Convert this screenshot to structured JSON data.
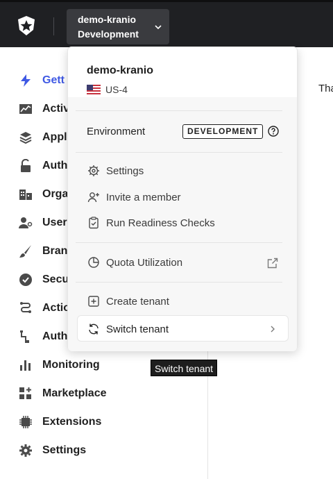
{
  "header": {
    "tenant_name": "demo-kranio",
    "tenant_environment": "Development"
  },
  "sidebar": {
    "items": [
      {
        "label": "Gett",
        "icon": "lightning-icon",
        "active": true
      },
      {
        "label": "Activ",
        "icon": "activity-chart-icon"
      },
      {
        "label": "Appl",
        "icon": "layers-icon"
      },
      {
        "label": "Auth",
        "icon": "unlock-icon"
      },
      {
        "label": "Orga",
        "icon": "buildings-icon"
      },
      {
        "label": "User",
        "icon": "users-icon"
      },
      {
        "label": "Bran",
        "icon": "brush-icon"
      },
      {
        "label": "Secu",
        "icon": "shield-icon"
      },
      {
        "label": "Actio",
        "icon": "actions-flow-icon"
      },
      {
        "label": "Auth",
        "icon": "auth-pipeline-icon"
      },
      {
        "label": "Monitoring",
        "icon": "bar-chart-icon"
      },
      {
        "label": "Marketplace",
        "icon": "grid-plus-icon"
      },
      {
        "label": "Extensions",
        "icon": "chip-icon"
      },
      {
        "label": "Settings",
        "icon": "gear-icon"
      }
    ]
  },
  "main": {
    "partial_text": "Tha"
  },
  "dropdown": {
    "tenant_name": "demo-kranio",
    "region": "US-4",
    "environment_label": "Environment",
    "environment_badge": "DEVELOPMENT",
    "items": {
      "settings": "Settings",
      "invite": "Invite a member",
      "readiness": "Run Readiness Checks",
      "quota": "Quota Utilization",
      "create_tenant": "Create tenant",
      "switch_tenant": "Switch tenant"
    }
  },
  "tooltip": {
    "text": "Switch tenant"
  },
  "colors": {
    "topbar": "#1f2023",
    "accent": "#3f59e4",
    "tooltip_bg": "#1e1e1e"
  }
}
